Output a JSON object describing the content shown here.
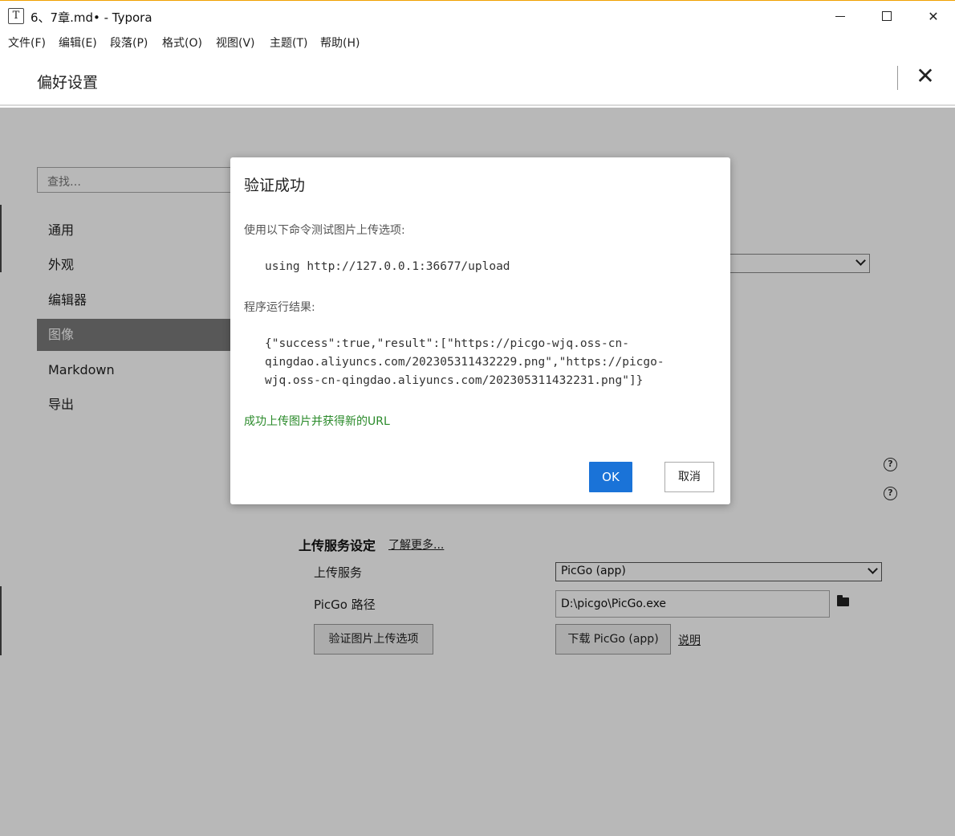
{
  "window": {
    "app_icon_letter": "T",
    "title": "6、7章.md• - Typora",
    "minimize": "",
    "maximize": "",
    "close": "✕"
  },
  "menubar": [
    "文件(F)",
    "编辑(E)",
    "段落(P)",
    "格式(O)",
    "视图(V)",
    "主题(T)",
    "帮助(H)"
  ],
  "preferences": {
    "title": "偏好设置",
    "close": "✕",
    "search_placeholder": "查找…",
    "sidebar": [
      {
        "label": "通用",
        "active": false
      },
      {
        "label": "外观",
        "active": false
      },
      {
        "label": "编辑器",
        "active": false
      },
      {
        "label": "图像",
        "active": true
      },
      {
        "label": "Markdown",
        "active": false
      },
      {
        "label": "导出",
        "active": false
      }
    ],
    "upload": {
      "section_title": "上传服务设定",
      "learn_more": "了解更多...",
      "service_label": "上传服务",
      "service_value": "PicGo (app)",
      "path_label": "PicGo 路径",
      "path_value": "D:\\picgo\\PicGo.exe",
      "verify_button": "验证图片上传选项",
      "download_button": "下载 PicGo (app)",
      "explain_link": "说明"
    },
    "help_icon": "?"
  },
  "dialog": {
    "title": "验证成功",
    "intro": "使用以下命令测试图片上传选项:",
    "command": "using http://127.0.0.1:36677/upload",
    "result_label": "程序运行结果:",
    "result_lines": [
      "{\"success\":true,\"result\":[\"https://picgo-wjq.oss-cn-",
      "qingdao.aliyuncs.com/202305311432229.png\",\"https://picgo-",
      "wjq.oss-cn-qingdao.aliyuncs.com/202305311432231.png\"]}"
    ],
    "success_message": "成功上传图片并获得新的URL",
    "ok_button": "OK",
    "cancel_button": "取消"
  },
  "colors": {
    "primary_button": "#1a73d8",
    "success_text": "#2a8a2a",
    "active_sidebar": "#7a7a7a"
  }
}
